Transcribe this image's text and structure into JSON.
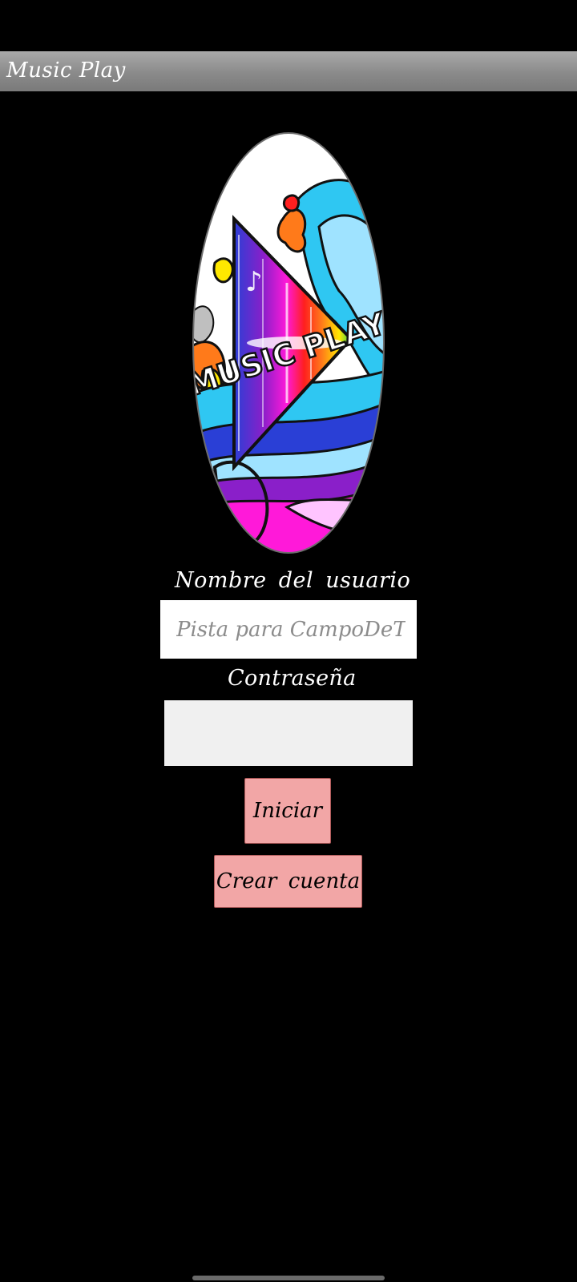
{
  "app": {
    "title": "Music Play"
  },
  "logo": {
    "text": "MUSIC PLAY",
    "colors": {
      "outline": "#111111",
      "sky": "#2fc7f2",
      "deep_blue": "#2a3fd6",
      "purple": "#8a1fc9",
      "magenta": "#ff19d9",
      "orange": "#ff7a1a",
      "yellow": "#ffe800",
      "red": "#ff1f1f",
      "light_blue": "#9fe3ff"
    }
  },
  "form": {
    "username_label": "Nombre del  usuario",
    "username_placeholder": "Pista para CampoDeTexto",
    "password_label": "Contraseña",
    "login_button": "Iniciar",
    "create_account_button": "Crear cuenta"
  },
  "theme": {
    "background": "#000000",
    "titlebar": "#8a8a8a",
    "button_fill": "#f2a6a6",
    "button_border": "#b05a5a"
  }
}
